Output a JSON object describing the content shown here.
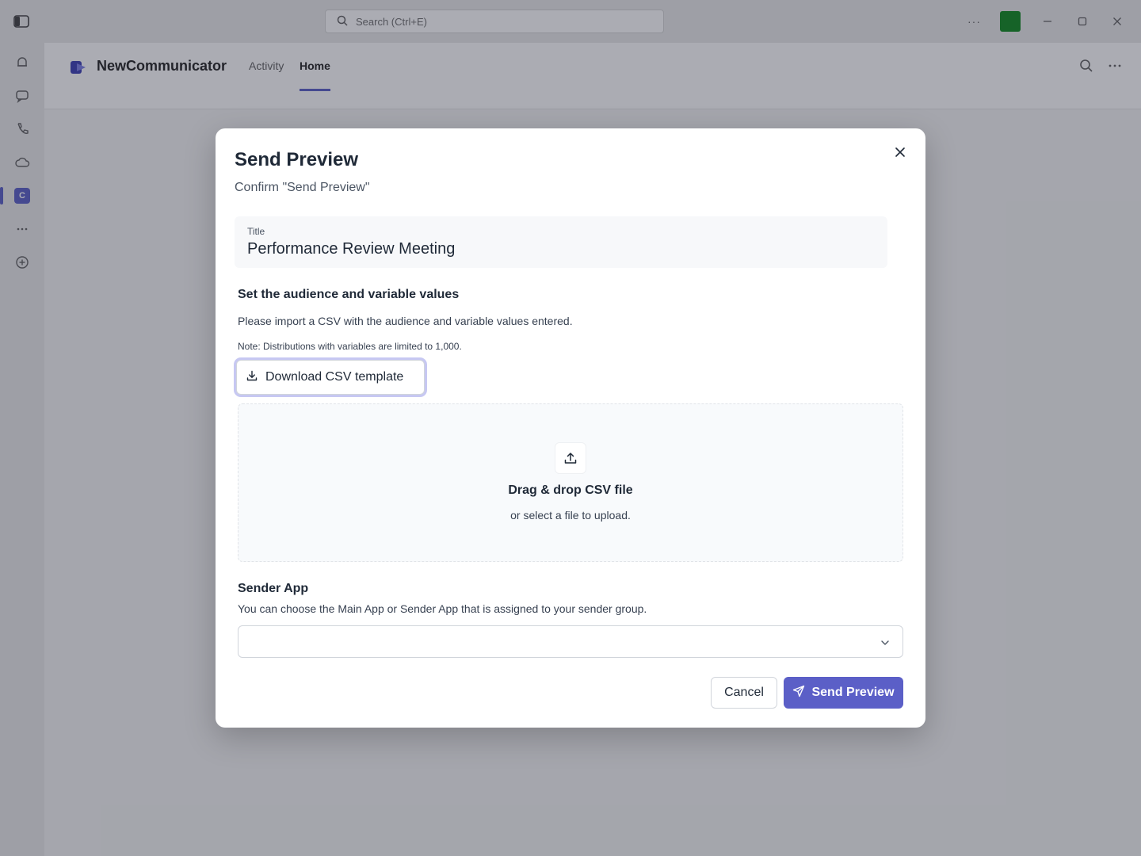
{
  "background": {
    "search_placeholder": "Search (Ctrl+E)",
    "more_label": "···",
    "app_name": "NewCommunicator",
    "tabs": [
      {
        "label": "Activity"
      },
      {
        "label": "Home"
      }
    ],
    "active_tab": "Home",
    "accent_color": "#5b5fc7"
  },
  "dialog": {
    "title": "Send Preview",
    "subtitle": "Confirm \"Send Preview\"",
    "close_icon": "close-icon",
    "title_field": {
      "label": "Title",
      "value": "Performance Review Meeting"
    },
    "audience": {
      "heading": "Set the audience and variable values",
      "description": "Please import a CSV with the audience and variable values entered.",
      "note": "Note: Distributions with variables are limited to 1,000.",
      "download_button": "Download CSV template",
      "dropzone_title": "Drag & drop CSV file",
      "dropzone_subtitle": "or select a file to upload."
    },
    "sender": {
      "heading": "Sender App",
      "description": "You can choose the Main App or Sender App that is assigned to your sender group.",
      "selected_value": ""
    },
    "actions": {
      "cancel": "Cancel",
      "send": "Send Preview"
    }
  }
}
